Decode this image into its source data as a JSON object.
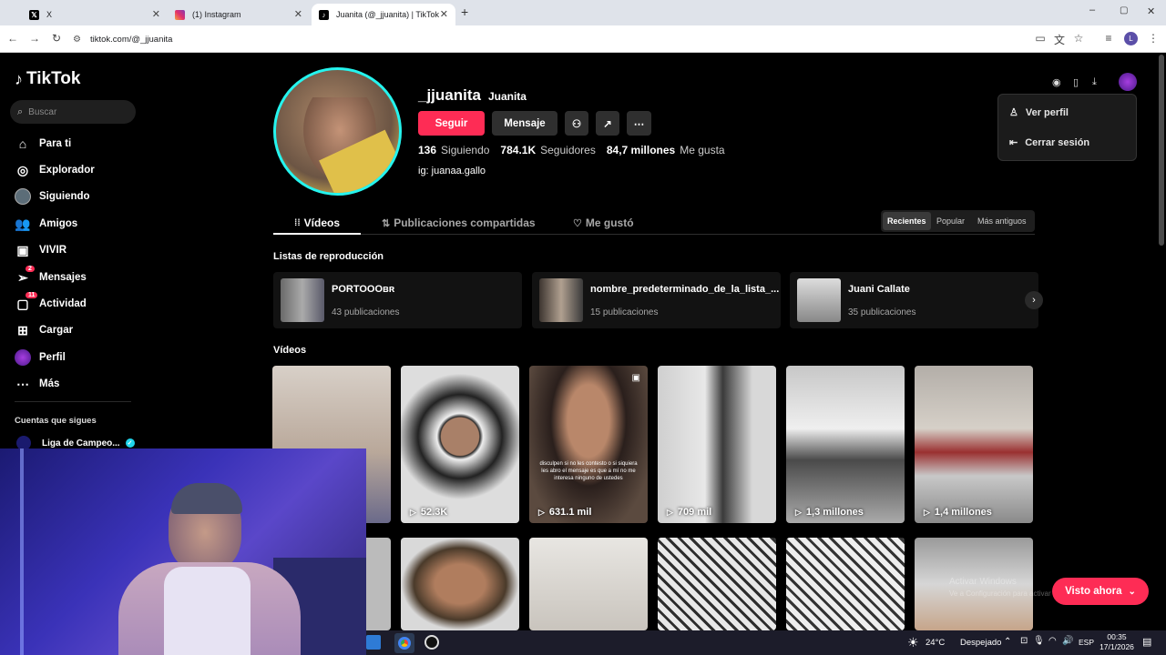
{
  "browser": {
    "tabs": [
      {
        "title": "X",
        "icon": "x-logo-icon"
      },
      {
        "title": "(1) Instagram",
        "icon": "instagram-icon"
      },
      {
        "title": "Juanita (@_jjuanita) | TikTok",
        "icon": "tiktok-icon",
        "active": true
      }
    ],
    "new_tab": "+",
    "url": "tiktok.com/@_jjuanita",
    "profile_initial": "L",
    "window_controls": {
      "minimize": "–",
      "maximize": "▢",
      "close": "✕"
    }
  },
  "sidebar": {
    "logo": "TikTok",
    "search_placeholder": "Buscar",
    "items": [
      {
        "label": "Para ti",
        "icon": "home-icon"
      },
      {
        "label": "Explorador",
        "icon": "compass-icon"
      },
      {
        "label": "Siguiendo",
        "icon": "following-avatar-icon"
      },
      {
        "label": "Amigos",
        "icon": "friends-icon"
      },
      {
        "label": "VIVIR",
        "icon": "live-icon"
      },
      {
        "label": "Mensajes",
        "icon": "message-icon",
        "badge": "2"
      },
      {
        "label": "Actividad",
        "icon": "activity-icon",
        "badge": "11"
      },
      {
        "label": "Cargar",
        "icon": "upload-icon"
      },
      {
        "label": "Perfil",
        "icon": "profile-avatar-icon"
      },
      {
        "label": "Más",
        "icon": "more-icon"
      }
    ],
    "following_header": "Cuentas que sigues",
    "following": [
      {
        "name": "Liga de Campeo..."
      }
    ]
  },
  "profile": {
    "username": "_jjuanita",
    "display_name": "Juanita",
    "follow_label": "Seguir",
    "message_label": "Mensaje",
    "following_count": "136",
    "following_label": "Siguiendo",
    "followers_count": "784.1K",
    "followers_label": "Seguidores",
    "likes_count": "84,7 millones",
    "likes_label": "Me gusta",
    "bio": "ig: juanaa.gallo"
  },
  "tabs": [
    {
      "label": "Vídeos",
      "icon": "grid-icon",
      "active": true
    },
    {
      "label": "Publicaciones compartidas",
      "icon": "repost-icon"
    },
    {
      "label": "Me gustó",
      "icon": "heart-icon"
    }
  ],
  "sort": {
    "options": [
      "Recientes",
      "Popular",
      "Más antiguos"
    ],
    "selected": "Recientes"
  },
  "playlists": {
    "heading": "Listas de reproducción",
    "items": [
      {
        "title": "PORTOOOʙʀ",
        "count": "43 publicaciones"
      },
      {
        "title": "nombre_predeterminado_de_la_lista_...",
        "count": "15 publicaciones"
      },
      {
        "title": "Juani Callate",
        "count": "35 publicaciones"
      }
    ]
  },
  "videos": {
    "heading": "Vídeos",
    "items": [
      {
        "views": ""
      },
      {
        "views": "52.3K"
      },
      {
        "views": "631.1 mil",
        "caption": "disculpen si no les contesto o si siquiera les abro el mensaje es que a mí no me interesa ninguno de ustedes"
      },
      {
        "views": "709 mil"
      },
      {
        "views": "1,3 millones"
      },
      {
        "views": "1,4 millones"
      }
    ]
  },
  "dropdown": {
    "items": [
      {
        "label": "Ver perfil",
        "icon": "person-icon"
      },
      {
        "label": "Cerrar sesión",
        "icon": "logout-icon"
      }
    ]
  },
  "visto_ahora": "Visto ahora",
  "taskbar": {
    "weather_temp": "24°C",
    "weather_desc": "Despejado",
    "lang": "ESP",
    "time": "00:35",
    "date": "17/1/2026"
  },
  "watermark": {
    "line1": "Activar Windows",
    "line2": "Ve a Configuración para activar Windows."
  }
}
